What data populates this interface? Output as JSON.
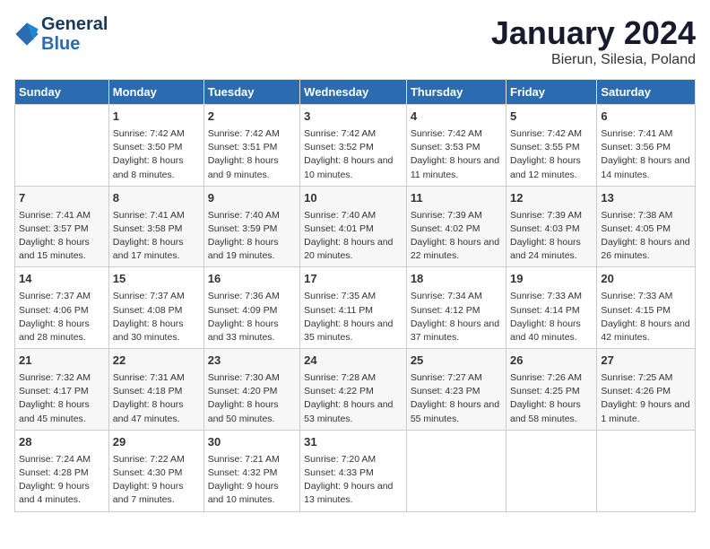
{
  "header": {
    "logo_line1": "General",
    "logo_line2": "Blue",
    "title": "January 2024",
    "subtitle": "Bierun, Silesia, Poland"
  },
  "calendar": {
    "days_of_week": [
      "Sunday",
      "Monday",
      "Tuesday",
      "Wednesday",
      "Thursday",
      "Friday",
      "Saturday"
    ],
    "weeks": [
      [
        {
          "num": "",
          "sunrise": "",
          "sunset": "",
          "daylight": ""
        },
        {
          "num": "1",
          "sunrise": "Sunrise: 7:42 AM",
          "sunset": "Sunset: 3:50 PM",
          "daylight": "Daylight: 8 hours and 8 minutes."
        },
        {
          "num": "2",
          "sunrise": "Sunrise: 7:42 AM",
          "sunset": "Sunset: 3:51 PM",
          "daylight": "Daylight: 8 hours and 9 minutes."
        },
        {
          "num": "3",
          "sunrise": "Sunrise: 7:42 AM",
          "sunset": "Sunset: 3:52 PM",
          "daylight": "Daylight: 8 hours and 10 minutes."
        },
        {
          "num": "4",
          "sunrise": "Sunrise: 7:42 AM",
          "sunset": "Sunset: 3:53 PM",
          "daylight": "Daylight: 8 hours and 11 minutes."
        },
        {
          "num": "5",
          "sunrise": "Sunrise: 7:42 AM",
          "sunset": "Sunset: 3:55 PM",
          "daylight": "Daylight: 8 hours and 12 minutes."
        },
        {
          "num": "6",
          "sunrise": "Sunrise: 7:41 AM",
          "sunset": "Sunset: 3:56 PM",
          "daylight": "Daylight: 8 hours and 14 minutes."
        }
      ],
      [
        {
          "num": "7",
          "sunrise": "Sunrise: 7:41 AM",
          "sunset": "Sunset: 3:57 PM",
          "daylight": "Daylight: 8 hours and 15 minutes."
        },
        {
          "num": "8",
          "sunrise": "Sunrise: 7:41 AM",
          "sunset": "Sunset: 3:58 PM",
          "daylight": "Daylight: 8 hours and 17 minutes."
        },
        {
          "num": "9",
          "sunrise": "Sunrise: 7:40 AM",
          "sunset": "Sunset: 3:59 PM",
          "daylight": "Daylight: 8 hours and 19 minutes."
        },
        {
          "num": "10",
          "sunrise": "Sunrise: 7:40 AM",
          "sunset": "Sunset: 4:01 PM",
          "daylight": "Daylight: 8 hours and 20 minutes."
        },
        {
          "num": "11",
          "sunrise": "Sunrise: 7:39 AM",
          "sunset": "Sunset: 4:02 PM",
          "daylight": "Daylight: 8 hours and 22 minutes."
        },
        {
          "num": "12",
          "sunrise": "Sunrise: 7:39 AM",
          "sunset": "Sunset: 4:03 PM",
          "daylight": "Daylight: 8 hours and 24 minutes."
        },
        {
          "num": "13",
          "sunrise": "Sunrise: 7:38 AM",
          "sunset": "Sunset: 4:05 PM",
          "daylight": "Daylight: 8 hours and 26 minutes."
        }
      ],
      [
        {
          "num": "14",
          "sunrise": "Sunrise: 7:37 AM",
          "sunset": "Sunset: 4:06 PM",
          "daylight": "Daylight: 8 hours and 28 minutes."
        },
        {
          "num": "15",
          "sunrise": "Sunrise: 7:37 AM",
          "sunset": "Sunset: 4:08 PM",
          "daylight": "Daylight: 8 hours and 30 minutes."
        },
        {
          "num": "16",
          "sunrise": "Sunrise: 7:36 AM",
          "sunset": "Sunset: 4:09 PM",
          "daylight": "Daylight: 8 hours and 33 minutes."
        },
        {
          "num": "17",
          "sunrise": "Sunrise: 7:35 AM",
          "sunset": "Sunset: 4:11 PM",
          "daylight": "Daylight: 8 hours and 35 minutes."
        },
        {
          "num": "18",
          "sunrise": "Sunrise: 7:34 AM",
          "sunset": "Sunset: 4:12 PM",
          "daylight": "Daylight: 8 hours and 37 minutes."
        },
        {
          "num": "19",
          "sunrise": "Sunrise: 7:33 AM",
          "sunset": "Sunset: 4:14 PM",
          "daylight": "Daylight: 8 hours and 40 minutes."
        },
        {
          "num": "20",
          "sunrise": "Sunrise: 7:33 AM",
          "sunset": "Sunset: 4:15 PM",
          "daylight": "Daylight: 8 hours and 42 minutes."
        }
      ],
      [
        {
          "num": "21",
          "sunrise": "Sunrise: 7:32 AM",
          "sunset": "Sunset: 4:17 PM",
          "daylight": "Daylight: 8 hours and 45 minutes."
        },
        {
          "num": "22",
          "sunrise": "Sunrise: 7:31 AM",
          "sunset": "Sunset: 4:18 PM",
          "daylight": "Daylight: 8 hours and 47 minutes."
        },
        {
          "num": "23",
          "sunrise": "Sunrise: 7:30 AM",
          "sunset": "Sunset: 4:20 PM",
          "daylight": "Daylight: 8 hours and 50 minutes."
        },
        {
          "num": "24",
          "sunrise": "Sunrise: 7:28 AM",
          "sunset": "Sunset: 4:22 PM",
          "daylight": "Daylight: 8 hours and 53 minutes."
        },
        {
          "num": "25",
          "sunrise": "Sunrise: 7:27 AM",
          "sunset": "Sunset: 4:23 PM",
          "daylight": "Daylight: 8 hours and 55 minutes."
        },
        {
          "num": "26",
          "sunrise": "Sunrise: 7:26 AM",
          "sunset": "Sunset: 4:25 PM",
          "daylight": "Daylight: 8 hours and 58 minutes."
        },
        {
          "num": "27",
          "sunrise": "Sunrise: 7:25 AM",
          "sunset": "Sunset: 4:26 PM",
          "daylight": "Daylight: 9 hours and 1 minute."
        }
      ],
      [
        {
          "num": "28",
          "sunrise": "Sunrise: 7:24 AM",
          "sunset": "Sunset: 4:28 PM",
          "daylight": "Daylight: 9 hours and 4 minutes."
        },
        {
          "num": "29",
          "sunrise": "Sunrise: 7:22 AM",
          "sunset": "Sunset: 4:30 PM",
          "daylight": "Daylight: 9 hours and 7 minutes."
        },
        {
          "num": "30",
          "sunrise": "Sunrise: 7:21 AM",
          "sunset": "Sunset: 4:32 PM",
          "daylight": "Daylight: 9 hours and 10 minutes."
        },
        {
          "num": "31",
          "sunrise": "Sunrise: 7:20 AM",
          "sunset": "Sunset: 4:33 PM",
          "daylight": "Daylight: 9 hours and 13 minutes."
        },
        {
          "num": "",
          "sunrise": "",
          "sunset": "",
          "daylight": ""
        },
        {
          "num": "",
          "sunrise": "",
          "sunset": "",
          "daylight": ""
        },
        {
          "num": "",
          "sunrise": "",
          "sunset": "",
          "daylight": ""
        }
      ]
    ]
  }
}
